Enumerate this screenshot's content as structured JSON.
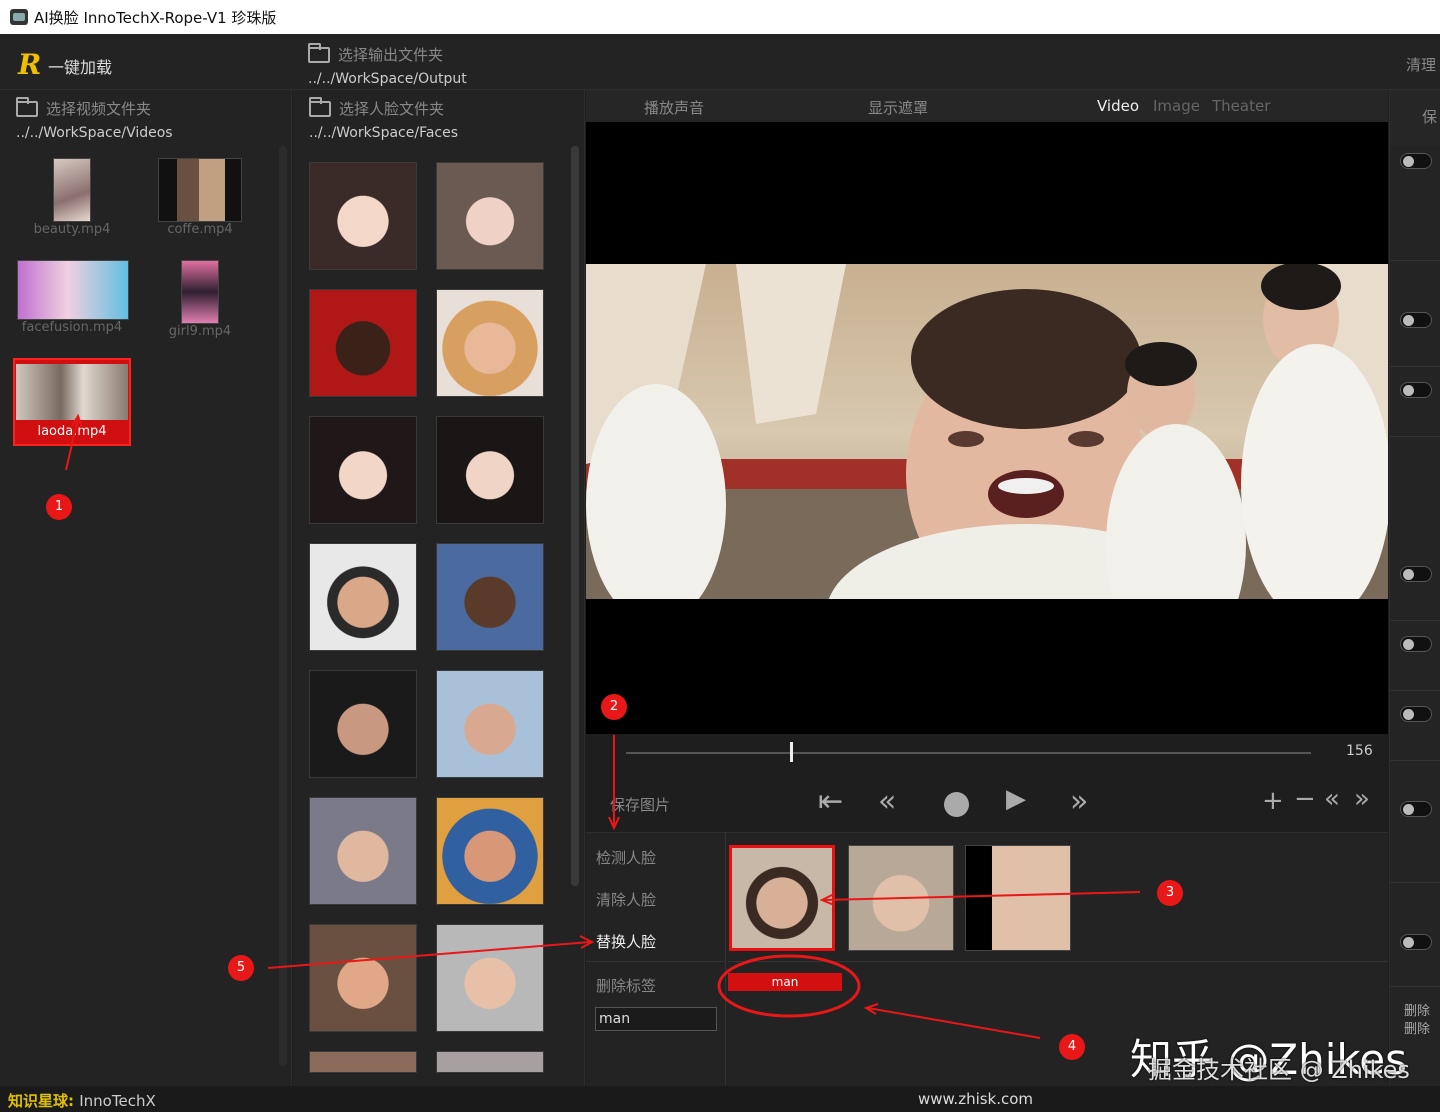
{
  "window": {
    "title": "AI换脸  InnoTechX-Rope-V1 珍珠版"
  },
  "top": {
    "logo": "R",
    "one_click_load": "一键加载",
    "output_folder": {
      "label": "选择输出文件夹",
      "path": "../../WorkSpace/Output"
    },
    "clear": "清理"
  },
  "videos_panel": {
    "label": "选择视频文件夹",
    "path": "../../WorkSpace/Videos",
    "items": [
      {
        "name": "beauty.mp4"
      },
      {
        "name": "coffe.mp4"
      },
      {
        "name": "facefusion.mp4"
      },
      {
        "name": "girl9.mp4"
      },
      {
        "name": "laoda.mp4",
        "selected": true
      }
    ]
  },
  "faces_panel": {
    "label": "选择人脸文件夹",
    "path": "../../WorkSpace/Faces"
  },
  "tabs": {
    "play_audio": "播放声音",
    "show_mask": "显示遮罩",
    "video": "Video",
    "image": "Image",
    "theater": "Theater",
    "right_cut": "保"
  },
  "player": {
    "frame_count": "156",
    "position_fraction": 0.24,
    "save_image": "保存图片"
  },
  "actions": {
    "detect": "检测人脸",
    "clear": "清除人脸",
    "swap": "替换人脸",
    "delete_tag": "删除标签",
    "tag_input": "man",
    "tag_button": "man"
  },
  "right_panel": {
    "delete_1": "删除",
    "delete_2": "删除"
  },
  "status": {
    "star_label": "知识星球:",
    "star_brand": "InnoTechX",
    "site": "www.zhisk.com"
  },
  "watermark": {
    "line1": "知乎 @Zhikes",
    "line2": "掘金技术社区 @ Zhikes"
  },
  "markers": [
    "1",
    "2",
    "3",
    "4",
    "5"
  ],
  "colors": {
    "accent": "#e81818",
    "logo": "#f0c000",
    "bg": "#1e1e1e"
  }
}
